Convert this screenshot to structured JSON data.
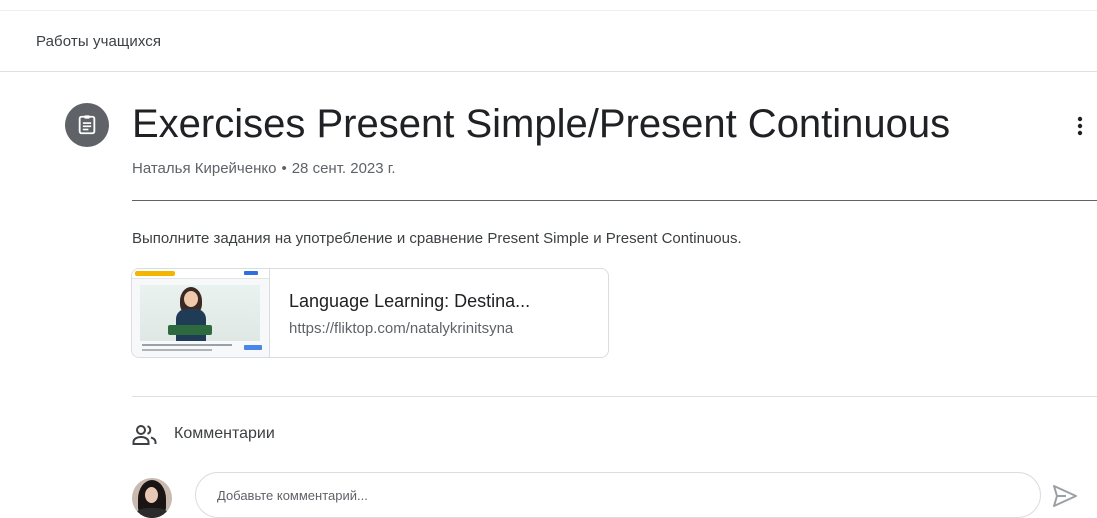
{
  "nav": {
    "tab_label": "Работы учащихся"
  },
  "assignment": {
    "icon": "assignment-icon",
    "title": "Exercises Present Simple/Present Continuous",
    "author": "Наталья Кирейченко",
    "separator": "•",
    "date": "28 сент. 2023 г.",
    "description": "Выполните задания на употребление и сравнение Present Simple и Present Continuous.",
    "more_icon": "more-vert-icon"
  },
  "attachment": {
    "title": "Language Learning: Destina...",
    "url": "https://fliktop.com/natalykrinitsyna"
  },
  "comments": {
    "icon": "people-icon",
    "title": "Комментарии",
    "input_placeholder": "Добавьте комментарий...",
    "send_icon": "send-icon"
  },
  "colors": {
    "text_primary": "#202124",
    "text_secondary": "#5f6368",
    "icon_circle": "#5f6368",
    "border": "#dadce0"
  }
}
